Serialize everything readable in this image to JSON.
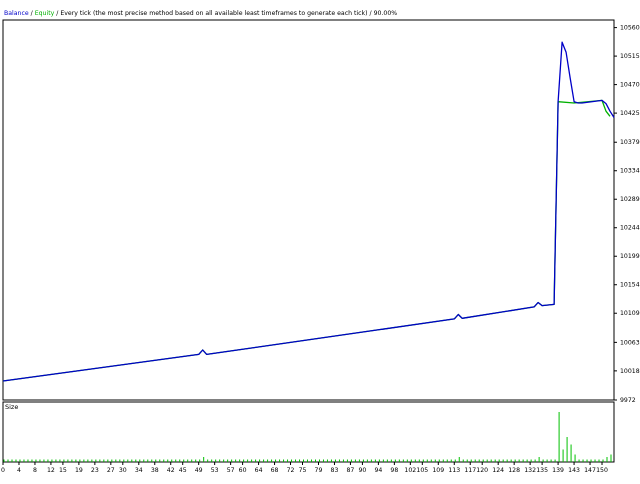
{
  "chart_data": [
    {
      "type": "line",
      "legend": {
        "items": [
          "Balance",
          "Equity"
        ],
        "colors": [
          "#0000c8",
          "#00b000"
        ],
        "separator": " / ",
        "description": "Every tick (the most precise method based on all available least timeframes to generate each tick)",
        "quality": "90.00%"
      },
      "title": "",
      "xlabel": "",
      "ylabel": "",
      "x_ticks": [
        0,
        4,
        8,
        12,
        15,
        19,
        23,
        27,
        30,
        34,
        38,
        42,
        45,
        49,
        53,
        57,
        60,
        64,
        68,
        72,
        75,
        79,
        83,
        87,
        90,
        94,
        98,
        102,
        105,
        109,
        113,
        117,
        120,
        124,
        128,
        132,
        135,
        139,
        143,
        147,
        150
      ],
      "xlim": [
        0,
        153
      ],
      "y_ticks": [
        9972,
        10018,
        10063,
        10109,
        10154,
        10199,
        10244,
        10289,
        10334,
        10379,
        10425,
        10470,
        10515,
        10560
      ],
      "ylim": [
        9972,
        10572
      ],
      "grid": false,
      "series": [
        {
          "name": "Balance",
          "color": "#0000c8",
          "x": [
            0,
            49,
            50,
            51,
            113,
            114,
            115,
            133,
            134,
            135,
            138,
            139,
            140,
            141,
            142,
            143,
            144,
            145,
            150,
            151,
            152,
            153
          ],
          "y": [
            10002,
            10044,
            10051,
            10044,
            10100,
            10107,
            10101,
            10119,
            10126,
            10121,
            10123,
            10443,
            10537,
            10521,
            10481,
            10443,
            10441,
            10441,
            10445,
            10440,
            10428,
            10418
          ]
        },
        {
          "name": "Equity",
          "color": "#00b000",
          "x": [
            0,
            49,
            50,
            51,
            113,
            114,
            115,
            133,
            134,
            135,
            138,
            139,
            143,
            150,
            151,
            152
          ],
          "y": [
            10002,
            10044,
            10051,
            10044,
            10100,
            10107,
            10101,
            10119,
            10126,
            10121,
            10123,
            10443,
            10441,
            10445,
            10428,
            10420
          ]
        }
      ]
    },
    {
      "type": "bar",
      "label": "Size",
      "color": "#00c000",
      "xlim": [
        0,
        153
      ],
      "ylim": [
        0,
        1
      ],
      "x": [
        0,
        1,
        2,
        3,
        4,
        5,
        6,
        7,
        8,
        9,
        10,
        11,
        12,
        13,
        14,
        15,
        16,
        17,
        18,
        19,
        20,
        21,
        22,
        23,
        24,
        25,
        26,
        27,
        28,
        29,
        30,
        31,
        32,
        33,
        34,
        35,
        36,
        37,
        38,
        39,
        40,
        41,
        42,
        43,
        44,
        45,
        46,
        47,
        48,
        49,
        50,
        51,
        52,
        53,
        54,
        55,
        56,
        57,
        58,
        59,
        60,
        61,
        62,
        63,
        64,
        65,
        66,
        67,
        68,
        69,
        70,
        71,
        72,
        73,
        74,
        75,
        76,
        77,
        78,
        79,
        80,
        81,
        82,
        83,
        84,
        85,
        86,
        87,
        88,
        89,
        90,
        91,
        92,
        93,
        94,
        95,
        96,
        97,
        98,
        99,
        100,
        101,
        102,
        103,
        104,
        105,
        106,
        107,
        108,
        109,
        110,
        111,
        112,
        113,
        114,
        115,
        116,
        117,
        118,
        119,
        120,
        121,
        122,
        123,
        124,
        125,
        126,
        127,
        128,
        129,
        130,
        131,
        132,
        133,
        134,
        135,
        136,
        137,
        138,
        139,
        140,
        141,
        142,
        143,
        144,
        145,
        146,
        147,
        148,
        149,
        150,
        151,
        152
      ],
      "values": [
        0.05,
        0.05,
        0.05,
        0.05,
        0.05,
        0.05,
        0.05,
        0.05,
        0.05,
        0.05,
        0.05,
        0.05,
        0.05,
        0.05,
        0.05,
        0.05,
        0.05,
        0.05,
        0.05,
        0.05,
        0.05,
        0.05,
        0.05,
        0.05,
        0.05,
        0.05,
        0.05,
        0.05,
        0.05,
        0.05,
        0.05,
        0.05,
        0.05,
        0.05,
        0.05,
        0.05,
        0.05,
        0.05,
        0.05,
        0.05,
        0.05,
        0.05,
        0.05,
        0.05,
        0.05,
        0.05,
        0.05,
        0.05,
        0.05,
        0.05,
        0.1,
        0.05,
        0.05,
        0.05,
        0.05,
        0.05,
        0.05,
        0.05,
        0.05,
        0.05,
        0.05,
        0.05,
        0.05,
        0.05,
        0.05,
        0.05,
        0.05,
        0.05,
        0.05,
        0.05,
        0.05,
        0.05,
        0.05,
        0.05,
        0.05,
        0.05,
        0.05,
        0.05,
        0.05,
        0.05,
        0.05,
        0.05,
        0.05,
        0.05,
        0.05,
        0.05,
        0.05,
        0.05,
        0.05,
        0.05,
        0.05,
        0.05,
        0.05,
        0.05,
        0.05,
        0.05,
        0.05,
        0.05,
        0.05,
        0.05,
        0.05,
        0.05,
        0.05,
        0.05,
        0.05,
        0.05,
        0.05,
        0.05,
        0.05,
        0.05,
        0.05,
        0.05,
        0.05,
        0.05,
        0.1,
        0.05,
        0.05,
        0.05,
        0.05,
        0.05,
        0.05,
        0.05,
        0.05,
        0.05,
        0.05,
        0.05,
        0.05,
        0.05,
        0.05,
        0.05,
        0.05,
        0.05,
        0.05,
        0.05,
        0.1,
        0.05,
        0.05,
        0.05,
        0.05,
        1.0,
        0.25,
        0.5,
        0.35,
        0.15,
        0.05,
        0.05,
        0.05,
        0.05,
        0.05,
        0.05,
        0.05,
        0.1,
        0.15
      ]
    }
  ]
}
